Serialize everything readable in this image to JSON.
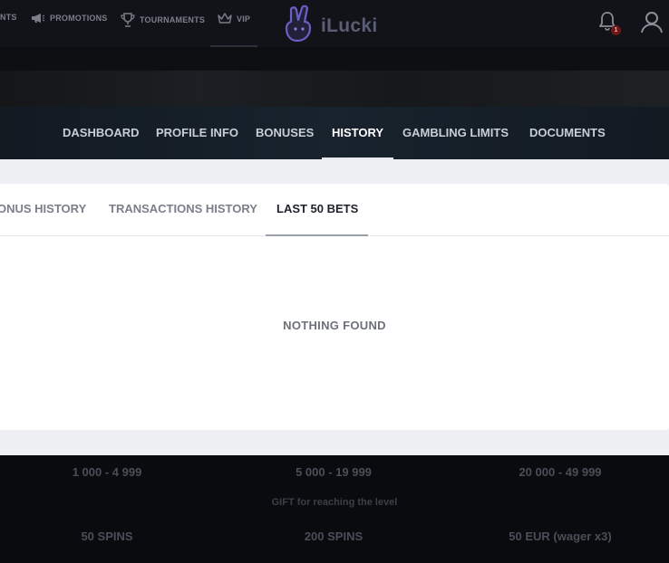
{
  "topnav": {
    "items": [
      {
        "label": "NTS",
        "icon": "none"
      },
      {
        "label": "PROMOTIONS",
        "icon": "megaphone-icon"
      },
      {
        "label": "TOURNAMENTS",
        "icon": "trophy-icon"
      },
      {
        "label": "VIP",
        "icon": "crown-icon"
      }
    ],
    "logo_text": "iLucki",
    "notification_count": "1"
  },
  "profile_tabs": [
    {
      "label": "DASHBOARD"
    },
    {
      "label": "PROFILE INFO"
    },
    {
      "label": "BONUSES"
    },
    {
      "label": "HISTORY",
      "active": true
    },
    {
      "label": "GAMBLING LIMITS"
    },
    {
      "label": "DOCUMENTS"
    }
  ],
  "history_tabs": [
    {
      "label": "ONUS HISTORY"
    },
    {
      "label": "TRANSACTIONS HISTORY"
    },
    {
      "label": "LAST 50 BETS",
      "active": true
    }
  ],
  "empty_message": "NOTHING FOUND",
  "vip_levels": {
    "ranges": [
      "1 000 - 4 999",
      "5 000 - 19 999",
      "20 000 - 49 999"
    ],
    "gift_caption": "GIFT for reaching the level",
    "rewards": [
      "50 SPINS",
      "200 SPINS",
      "50 EUR (wager x3)"
    ]
  },
  "colors": {
    "header_bg": "#111319",
    "tab_bar_bg": "#18232d",
    "content_bg": "#eef0f4",
    "card_bg": "#ffffff",
    "badge": "#6b1818"
  }
}
